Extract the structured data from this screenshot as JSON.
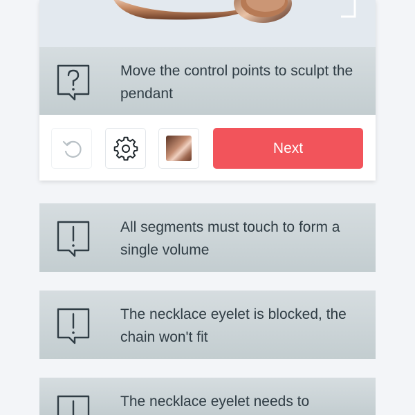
{
  "hint": {
    "text": "Move the control points to sculpt the pendant",
    "icon": "question-bubble-icon"
  },
  "toolbar": {
    "undo_icon": "undo-icon",
    "settings_icon": "gear-icon",
    "material_icon": "material-swatch",
    "next_label": "Next"
  },
  "warnings": [
    {
      "text": "All segments must touch to form a single volume",
      "icon": "exclamation-bubble-icon"
    },
    {
      "text": "The necklace eyelet is blocked, the chain won't fit",
      "icon": "exclamation-bubble-icon"
    },
    {
      "text": "The necklace eyelet needs to",
      "icon": "exclamation-bubble-icon"
    }
  ],
  "colors": {
    "accent": "#f2545b",
    "message_bg": "#c8d1d4",
    "text": "#2f3c44",
    "page_bg": "#f3f5f8"
  }
}
